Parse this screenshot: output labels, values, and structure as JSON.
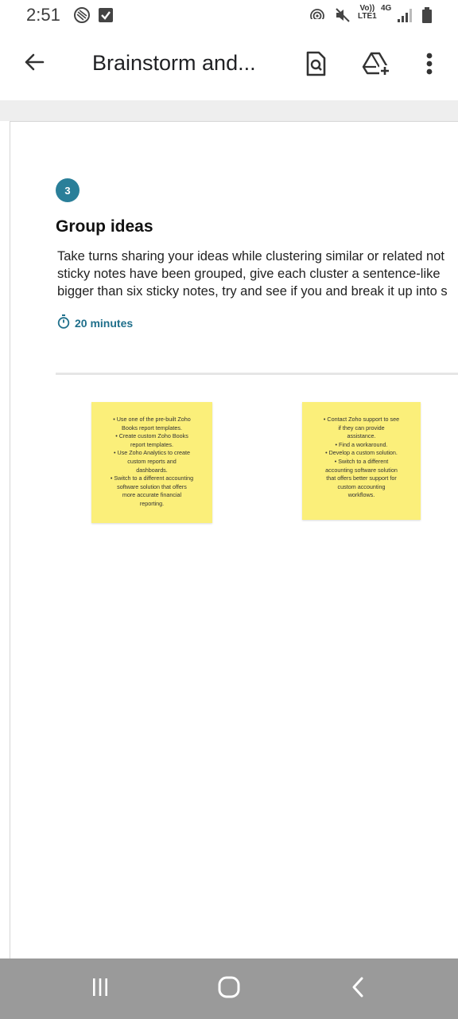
{
  "status_bar": {
    "time": "2:51",
    "network_top": "Vo))",
    "network_bottom": "LTE1",
    "network_type": "4G",
    "icons": [
      "shield-sync-icon",
      "checkbox-icon",
      "nfc-icon",
      "mute-icon",
      "signal-icon",
      "battery-icon"
    ]
  },
  "app_bar": {
    "title": "Brainstorm and...",
    "icons": [
      "back-arrow-icon",
      "document-search-icon",
      "add-drive-icon",
      "more-vert-icon"
    ]
  },
  "step": {
    "number": "3",
    "title": "Group ideas",
    "description_lines": [
      "Take turns sharing your ideas while clustering similar or related not",
      "sticky notes have been grouped, give each cluster a sentence-like",
      "bigger than six sticky notes, try and see if you and break it up into s"
    ],
    "timer": "20 minutes"
  },
  "sticky_notes": [
    {
      "lines": [
        "• Use one of the pre-built Zoho",
        "Books report templates.",
        "• Create custom Zoho Books",
        "report templates.",
        "• Use Zoho Analytics to create",
        "custom reports and",
        "dashboards.",
        "• Switch to a different accounting",
        "software solution that offers",
        "more accurate financial",
        "reporting."
      ]
    },
    {
      "lines": [
        "• Contact Zoho support to see",
        "if they can provide",
        "assistance.",
        "• Find a workaround.",
        "• Develop a custom solution.",
        "• Switch to a different",
        "accounting software solution",
        "that offers better support for",
        "custom accounting",
        "workflows."
      ]
    }
  ],
  "colors": {
    "accent": "#2a7f99",
    "timer": "#1f6f8b",
    "sticky": "#fbef7a",
    "nav_bar": "#9a9a9a"
  },
  "nav_bar": {
    "icons": [
      "recent-apps-icon",
      "home-icon",
      "back-icon"
    ]
  }
}
